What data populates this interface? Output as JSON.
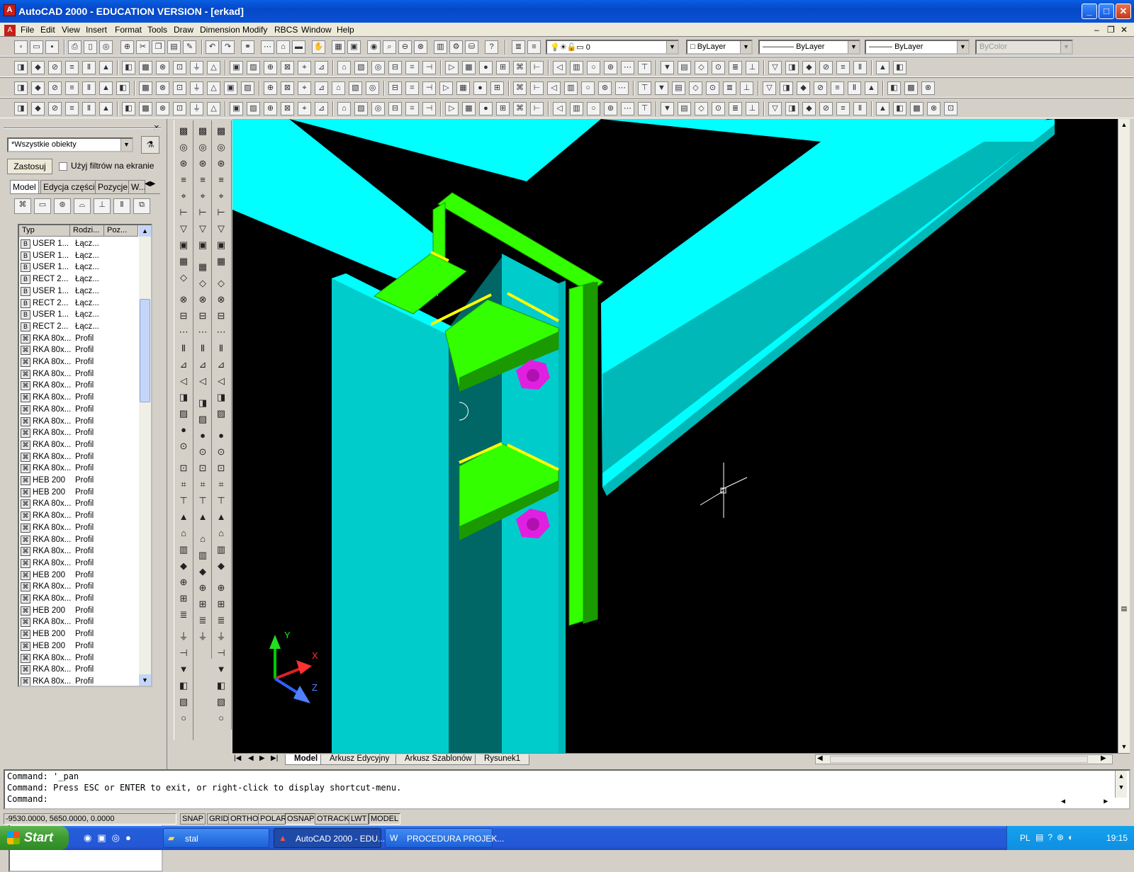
{
  "window": {
    "title": "AutoCAD 2000 - EDUCATION VERSION - [erkad]",
    "minimize_glyph": "_",
    "maximize_glyph": "□",
    "close_glyph": "✕"
  },
  "menubar": {
    "items": [
      "File",
      "Edit",
      "View",
      "Insert",
      "Format",
      "Tools",
      "Draw",
      "Dimension",
      "Modify",
      "RBCS",
      "Window",
      "Help"
    ],
    "doc_controls": [
      "–",
      "❐",
      "✕"
    ]
  },
  "properties_toolbar": {
    "layer_value": "0",
    "color_value": "ByLayer",
    "linetype_value": "ByLayer",
    "lineweight_value": "ByLayer",
    "plotstyle_value": "ByColor"
  },
  "left_panel": {
    "close_glyph": "×",
    "filter_value": "*Wszystkie obiekty",
    "apply_button": "Zastosuj",
    "screen_filter_label": "Użyj filtrów na ekranie",
    "tabs": [
      "Model",
      "Edycja części",
      "Pozycje",
      "W..."
    ],
    "columns": [
      "Typ",
      "Rodzi...",
      "Poz..."
    ],
    "rows": [
      {
        "type": "USER 1...",
        "kind": "Łącz...",
        "icon": "connection-icon"
      },
      {
        "type": "USER 1...",
        "kind": "Łącz...",
        "icon": "connection-icon"
      },
      {
        "type": "USER 1...",
        "kind": "Łącz...",
        "icon": "connection-icon"
      },
      {
        "type": "RECT 2...",
        "kind": "Łącz...",
        "icon": "connection-icon"
      },
      {
        "type": "USER 1...",
        "kind": "Łącz...",
        "icon": "connection-icon"
      },
      {
        "type": "RECT 2...",
        "kind": "Łącz...",
        "icon": "connection-icon"
      },
      {
        "type": "USER 1...",
        "kind": "Łącz...",
        "icon": "connection-icon"
      },
      {
        "type": "RECT 2...",
        "kind": "Łącz...",
        "icon": "connection-icon"
      },
      {
        "type": "RKA 80x...",
        "kind": "Profil",
        "icon": "profile-icon"
      },
      {
        "type": "RKA 80x...",
        "kind": "Profil",
        "icon": "profile-icon"
      },
      {
        "type": "RKA 80x...",
        "kind": "Profil",
        "icon": "profile-icon"
      },
      {
        "type": "RKA 80x...",
        "kind": "Profil",
        "icon": "profile-icon"
      },
      {
        "type": "RKA 80x...",
        "kind": "Profil",
        "icon": "profile-icon"
      },
      {
        "type": "RKA 80x...",
        "kind": "Profil",
        "icon": "profile-icon"
      },
      {
        "type": "RKA 80x...",
        "kind": "Profil",
        "icon": "profile-icon"
      },
      {
        "type": "RKA 80x...",
        "kind": "Profil",
        "icon": "profile-icon"
      },
      {
        "type": "RKA 80x...",
        "kind": "Profil",
        "icon": "profile-icon"
      },
      {
        "type": "RKA 80x...",
        "kind": "Profil",
        "icon": "profile-icon"
      },
      {
        "type": "RKA 80x...",
        "kind": "Profil",
        "icon": "profile-icon"
      },
      {
        "type": "RKA 80x...",
        "kind": "Profil",
        "icon": "profile-icon"
      },
      {
        "type": "HEB 200",
        "kind": "Profil",
        "icon": "profile-icon"
      },
      {
        "type": "HEB 200",
        "kind": "Profil",
        "icon": "profile-icon"
      },
      {
        "type": "RKA 80x...",
        "kind": "Profil",
        "icon": "profile-icon"
      },
      {
        "type": "RKA 80x...",
        "kind": "Profil",
        "icon": "profile-icon"
      },
      {
        "type": "RKA 80x...",
        "kind": "Profil",
        "icon": "profile-icon"
      },
      {
        "type": "RKA 80x...",
        "kind": "Profil",
        "icon": "profile-icon"
      },
      {
        "type": "RKA 80x...",
        "kind": "Profil",
        "icon": "profile-icon"
      },
      {
        "type": "RKA 80x...",
        "kind": "Profil",
        "icon": "profile-icon"
      },
      {
        "type": "HEB 200",
        "kind": "Profil",
        "icon": "profile-icon"
      },
      {
        "type": "RKA 80x...",
        "kind": "Profil",
        "icon": "profile-icon"
      },
      {
        "type": "RKA 80x...",
        "kind": "Profil",
        "icon": "profile-icon"
      },
      {
        "type": "HEB 200",
        "kind": "Profil",
        "icon": "profile-icon"
      },
      {
        "type": "RKA 80x...",
        "kind": "Profil",
        "icon": "profile-icon"
      },
      {
        "type": "HEB 200",
        "kind": "Profil",
        "icon": "profile-icon"
      },
      {
        "type": "HEB 200",
        "kind": "Profil",
        "icon": "profile-icon"
      },
      {
        "type": "RKA 80x...",
        "kind": "Profil",
        "icon": "profile-icon"
      },
      {
        "type": "RKA 80x...",
        "kind": "Profil",
        "icon": "profile-icon"
      },
      {
        "type": "RKA 80x...",
        "kind": "Profil",
        "icon": "profile-icon"
      }
    ]
  },
  "drawing": {
    "ucs_labels": {
      "y": "Y",
      "x": "X",
      "z": "Z"
    },
    "colors": {
      "background": "#000000",
      "beam": "#00ffff",
      "beam_shadow": "#00b8b8",
      "column": "#00cccc",
      "column_dark": "#006666",
      "plate": "#33ff00",
      "plate_dark": "#1a9900",
      "weld": "#ffff00",
      "bolt": "#e020e0"
    }
  },
  "layout_tabs": {
    "nav": [
      "|◀",
      "◀",
      "▶",
      "▶|"
    ],
    "tabs": [
      "Model",
      "Arkusz Edycyjny",
      "Arkusz Szablonów",
      "Rysunek1"
    ],
    "active": "Model"
  },
  "command_line": {
    "lines": [
      "Command:  '_pan",
      "Command: Press ESC or ENTER to exit, or right-click to display shortcut-menu."
    ],
    "prompt": "Command:"
  },
  "status_bar": {
    "coordinates": "-9530.0000, 5650.0000, 0.0000",
    "toggles": [
      {
        "label": "SNAP",
        "on": false
      },
      {
        "label": "GRID",
        "on": false
      },
      {
        "label": "ORTHO",
        "on": false
      },
      {
        "label": "POLAR",
        "on": false
      },
      {
        "label": "OSNAP",
        "on": true
      },
      {
        "label": "OTRACK",
        "on": false
      },
      {
        "label": "LWT",
        "on": false
      },
      {
        "label": "MODEL",
        "on": true
      }
    ]
  },
  "taskbar": {
    "start_label": "Start",
    "tasks": [
      {
        "label": "stal",
        "icon": "folder-icon",
        "active": false
      },
      {
        "label": "AutoCAD 2000 - EDU...",
        "icon": "autocad-icon",
        "active": true
      },
      {
        "label": "PROCEDURA PROJEK...",
        "icon": "word-icon",
        "active": false
      }
    ],
    "language": "PL",
    "clock": "19:15"
  }
}
